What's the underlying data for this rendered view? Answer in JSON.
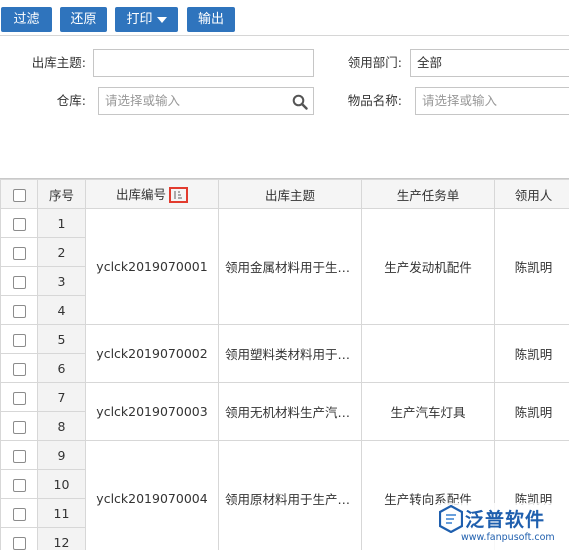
{
  "toolbar": {
    "filter_label": "过滤",
    "restore_label": "还原",
    "print_label": "打印",
    "export_label": "输出"
  },
  "filters": {
    "subject_label": "出库主题:",
    "subject_value": "",
    "dept_label": "领用部门:",
    "dept_value": "全部",
    "warehouse_label": "仓库:",
    "warehouse_placeholder": "请选择或输入",
    "item_label": "物品名称:",
    "item_placeholder": "请选择或输入"
  },
  "grid": {
    "columns": {
      "seq": "序号",
      "out_no": "出库编号",
      "subject": "出库主题",
      "task": "生产任务单",
      "receiver": "领用人"
    },
    "row_numbers": [
      "1",
      "2",
      "3",
      "4",
      "5",
      "6",
      "7",
      "8",
      "9",
      "10",
      "11",
      "12"
    ],
    "groups": [
      {
        "out_no": "yclck2019070001",
        "subject": "领用金属材料用于生产发动机配件",
        "task": "生产发动机配件",
        "receiver": "陈凯明"
      },
      {
        "out_no": "yclck2019070002",
        "subject": "领用塑料类材料用于生产",
        "task": "",
        "receiver": "陈凯明"
      },
      {
        "out_no": "yclck2019070003",
        "subject": "领用无机材料生产汽车灯具",
        "task": "生产汽车灯具",
        "receiver": "陈凯明"
      },
      {
        "out_no": "yclck2019070004",
        "subject": "领用原材料用于生产转向系配件",
        "task": "生产转向系配件",
        "receiver": "陈凯明"
      }
    ]
  },
  "logo": {
    "brand": "泛普软件",
    "url": "www.fanpusoft.com"
  }
}
